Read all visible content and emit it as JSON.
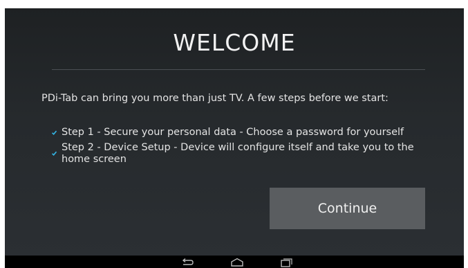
{
  "screen": {
    "title": "WELCOME",
    "intro": "PDi-Tab can bring you more than just TV. A few steps before we start:",
    "steps": [
      {
        "label": "Step 1 - Secure your personal data - Choose a password for yourself",
        "checked": true
      },
      {
        "label": "Step 2 - Device Setup - Device will configure itself and take you to the home screen",
        "checked": true
      }
    ],
    "continue_label": "Continue"
  },
  "navbar": {
    "icons": [
      "back-icon",
      "home-icon",
      "recent-apps-icon"
    ]
  },
  "colors": {
    "background_top": "#1e2123",
    "background_bottom": "#2b2f33",
    "check_accent": "#33b5e5",
    "button": "#5a5d60",
    "text": "#e4e4e4"
  }
}
